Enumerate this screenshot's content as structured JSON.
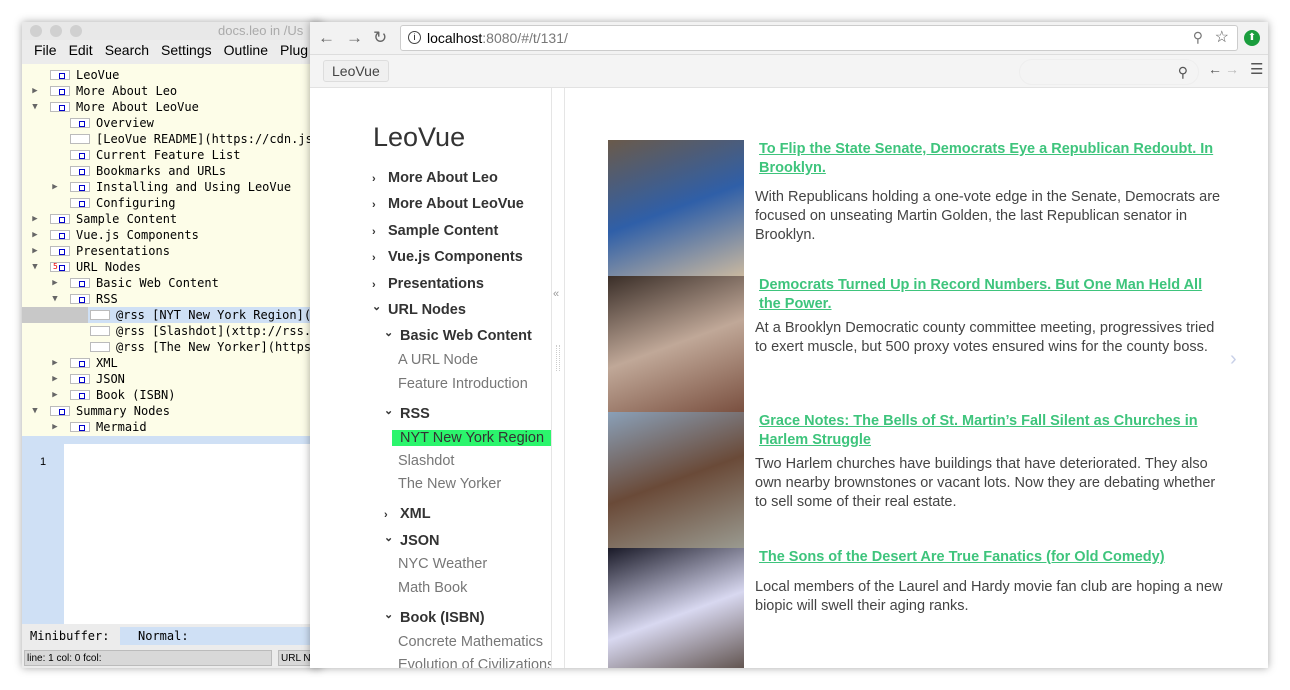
{
  "leo": {
    "title": "docs.leo in /Us",
    "menu": [
      "File",
      "Edit",
      "Search",
      "Settings",
      "Outline",
      "Plug"
    ],
    "outline": [
      {
        "text": "LeoVue",
        "level": 0,
        "arrow": "none",
        "icon": "box"
      },
      {
        "text": "More About Leo",
        "level": 0,
        "arrow": "right",
        "icon": "box"
      },
      {
        "text": "More About LeoVue",
        "level": 0,
        "arrow": "down",
        "icon": "box"
      },
      {
        "text": "Overview",
        "level": 1,
        "arrow": "none",
        "icon": "box"
      },
      {
        "text": "[LeoVue README](https://cdn.js",
        "level": 1,
        "arrow": "none",
        "icon": "empty"
      },
      {
        "text": "Current Feature List",
        "level": 1,
        "arrow": "none",
        "icon": "box"
      },
      {
        "text": "Bookmarks and URLs",
        "level": 1,
        "arrow": "none",
        "icon": "box"
      },
      {
        "text": "Installing and Using LeoVue",
        "level": 1,
        "arrow": "right",
        "icon": "box"
      },
      {
        "text": "Configuring",
        "level": 1,
        "arrow": "none",
        "icon": "box"
      },
      {
        "text": "Sample Content",
        "level": 0,
        "arrow": "right",
        "icon": "box"
      },
      {
        "text": "Vue.js Components",
        "level": 0,
        "arrow": "right",
        "icon": "box"
      },
      {
        "text": "Presentations",
        "level": 0,
        "arrow": "right",
        "icon": "box"
      },
      {
        "text": "URL Nodes",
        "level": 0,
        "arrow": "down",
        "icon": "clone"
      },
      {
        "text": "Basic Web Content",
        "level": 1,
        "arrow": "right",
        "icon": "box"
      },
      {
        "text": "RSS",
        "level": 1,
        "arrow": "down",
        "icon": "box"
      },
      {
        "text": "@rss [NYT New York Region](",
        "level": 2,
        "arrow": "none",
        "icon": "empty",
        "selected": true
      },
      {
        "text": "@rss [Slashdot](xttp://rss.",
        "level": 2,
        "arrow": "none",
        "icon": "empty"
      },
      {
        "text": "@rss [The New Yorker](https",
        "level": 2,
        "arrow": "none",
        "icon": "empty"
      },
      {
        "text": "XML",
        "level": 1,
        "arrow": "right",
        "icon": "box"
      },
      {
        "text": "JSON",
        "level": 1,
        "arrow": "right",
        "icon": "box"
      },
      {
        "text": "Book (ISBN)",
        "level": 1,
        "arrow": "right",
        "icon": "box"
      },
      {
        "text": "Summary Nodes",
        "level": 0,
        "arrow": "down",
        "icon": "box"
      },
      {
        "text": "Mermaid",
        "level": 1,
        "arrow": "right",
        "icon": "box"
      }
    ],
    "line_number": "1",
    "minibuffer_label": "Minibuffer:",
    "minibuffer_value": "Normal:",
    "status_left": "line: 1 col: 0 fcol:",
    "status_right": "URL No"
  },
  "browser": {
    "url_host": "localhost",
    "url_path": ":8080/#/t/131/",
    "bookmark": "LeoVue",
    "sidebar": {
      "brand": "LeoVue",
      "items": [
        {
          "text": "More About Leo",
          "level": 0,
          "kind": "b",
          "chev": "right"
        },
        {
          "text": "More About LeoVue",
          "level": 0,
          "kind": "b",
          "chev": "right"
        },
        {
          "text": "Sample Content",
          "level": 0,
          "kind": "b",
          "chev": "right"
        },
        {
          "text": "Vue.js Components",
          "level": 0,
          "kind": "b",
          "chev": "right"
        },
        {
          "text": "Presentations",
          "level": 0,
          "kind": "b",
          "chev": "right"
        },
        {
          "text": "URL Nodes",
          "level": 0,
          "kind": "b",
          "chev": "down"
        },
        {
          "text": "Basic Web Content",
          "level": 1,
          "kind": "b",
          "chev": "down"
        },
        {
          "text": "A URL Node",
          "level": 2,
          "kind": "l"
        },
        {
          "text": "Feature Introduction",
          "level": 2,
          "kind": "l"
        },
        {
          "text": "RSS",
          "level": 1,
          "kind": "b",
          "chev": "down"
        },
        {
          "text": "NYT New York Region",
          "level": 2,
          "kind": "l",
          "active": true
        },
        {
          "text": "Slashdot",
          "level": 2,
          "kind": "l"
        },
        {
          "text": "The New Yorker",
          "level": 2,
          "kind": "l"
        },
        {
          "text": "XML",
          "level": 1,
          "kind": "b",
          "chev": "right"
        },
        {
          "text": "JSON",
          "level": 1,
          "kind": "b",
          "chev": "down"
        },
        {
          "text": "NYC Weather",
          "level": 2,
          "kind": "l"
        },
        {
          "text": "Math Book",
          "level": 2,
          "kind": "l"
        },
        {
          "text": "Book (ISBN)",
          "level": 1,
          "kind": "b",
          "chev": "down"
        },
        {
          "text": "Concrete Mathematics",
          "level": 2,
          "kind": "l"
        },
        {
          "text": "Evolution of Civilizations",
          "level": 2,
          "kind": "l"
        }
      ]
    },
    "articles": [
      {
        "title": "To Flip the State Senate, Democrats Eye a Republican Redoubt. In Brooklyn.",
        "desc": "With Republicans holding a one-vote edge in the Senate, Democrats are focused on unseating Martin Golden, the last Republican senator in Brooklyn.",
        "colors": [
          "#6a5a4a",
          "#2f5fa8",
          "#c9b8a0"
        ]
      },
      {
        "title": "Democrats Turned Up in Record Numbers. But One Man Held All the Power.",
        "desc": "At a Brooklyn Democratic county committee meeting, progressives tried to exert muscle, but 500 proxy votes ensured wins for the county boss.",
        "colors": [
          "#3a2e28",
          "#c0a898",
          "#7a5040"
        ]
      },
      {
        "title": "Grace Notes: The Bells of St. Martin’s Fall Silent as Churches in Harlem Struggle",
        "desc": "Two Harlem churches have buildings that have deteriorated. They also own nearby brownstones or vacant lots. Now they are debating whether to sell some of their real estate.",
        "colors": [
          "#8aa0b8",
          "#6a4a38",
          "#9a9a90"
        ]
      },
      {
        "title": "The Sons of the Desert Are True Fanatics (for Old Comedy)",
        "desc": "Local members of the Laurel and Hardy movie fan club are hoping a new biopic will swell their aging ranks.",
        "colors": [
          "#1a1a28",
          "#d8d8f0",
          "#4a3a30"
        ]
      }
    ],
    "accent": "#3ec47c",
    "active_bg": "#2bf56c"
  }
}
